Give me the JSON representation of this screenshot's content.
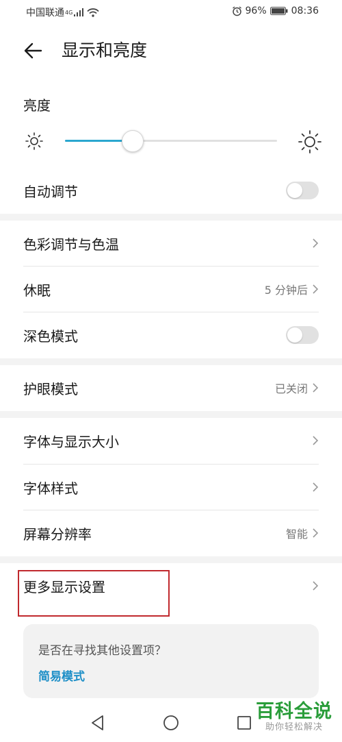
{
  "status_bar": {
    "carrier": "中国联通",
    "network_type": "4G",
    "battery_percent": "96%",
    "time": "08:36",
    "icons": [
      "signal-icon",
      "wifi-icon",
      "alarm-icon",
      "battery-icon"
    ]
  },
  "header": {
    "title": "显示和亮度",
    "back_icon": "back-arrow-icon"
  },
  "brightness": {
    "label": "亮度",
    "level": 0.32,
    "icons": [
      "sun-dim-icon",
      "sun-bright-icon"
    ]
  },
  "auto_adjust": {
    "label": "自动调节",
    "enabled": false
  },
  "items": {
    "color": {
      "label": "色彩调节与色温"
    },
    "sleep": {
      "label": "休眠",
      "value": "5 分钟后"
    },
    "dark_mode": {
      "label": "深色模式",
      "enabled": false
    },
    "eye_comfort": {
      "label": "护眼模式",
      "value": "已关闭"
    },
    "font_size": {
      "label": "字体与显示大小"
    },
    "font_style": {
      "label": "字体样式"
    },
    "resolution": {
      "label": "屏幕分辨率",
      "value": "智能"
    },
    "more": {
      "label": "更多显示设置"
    }
  },
  "suggestion": {
    "question": "是否在寻找其他设置项？",
    "link": "简易模式"
  },
  "nav_bar": {
    "icons": [
      "nav-back-icon",
      "nav-home-icon",
      "nav-recents-icon"
    ]
  },
  "watermark": {
    "title": "百科全说",
    "subtitle": "助你轻松解决"
  },
  "colors": {
    "accent": "#2aa7cf",
    "link": "#1e8fc7",
    "highlight_border": "#c0282d",
    "watermark_green": "#2a9d3a"
  }
}
